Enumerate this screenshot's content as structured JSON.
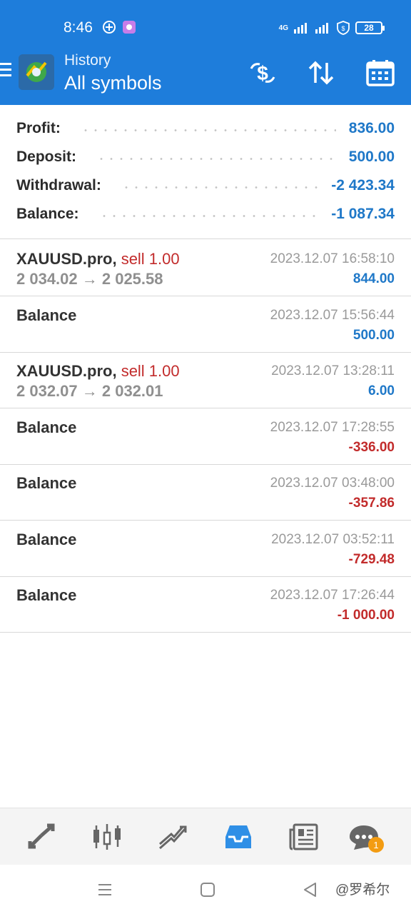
{
  "status_bar": {
    "time": "8:46",
    "network": "4G",
    "battery": "28"
  },
  "toolbar": {
    "title": "History",
    "subtitle": "All symbols"
  },
  "summary": {
    "rows": [
      {
        "label": "Profit:",
        "value": "836.00"
      },
      {
        "label": "Deposit:",
        "value": "500.00"
      },
      {
        "label": "Withdrawal:",
        "value": "-2 423.34"
      },
      {
        "label": "Balance:",
        "value": "-1 087.34"
      }
    ]
  },
  "deals": [
    {
      "symbol": "XAUUSD.pro,",
      "type": "sell 1.00",
      "prices": "2 034.02 → 2 025.58",
      "time": "2023.12.07 16:58:10",
      "profit": "844.00",
      "sign": "pos"
    },
    {
      "symbol": "Balance",
      "type": "",
      "prices": "",
      "time": "2023.12.07 15:56:44",
      "profit": "500.00",
      "sign": "pos"
    },
    {
      "symbol": "XAUUSD.pro,",
      "type": "sell 1.00",
      "prices": "2 032.07 → 2 032.01",
      "time": "2023.12.07 13:28:11",
      "profit": "6.00",
      "sign": "pos"
    },
    {
      "symbol": "Balance",
      "type": "",
      "prices": "",
      "time": "2023.12.07 17:28:55",
      "profit": "-336.00",
      "sign": "neg"
    },
    {
      "symbol": "Balance",
      "type": "",
      "prices": "",
      "time": "2023.12.07 03:48:00",
      "profit": "-357.86",
      "sign": "neg"
    },
    {
      "symbol": "Balance",
      "type": "",
      "prices": "",
      "time": "2023.12.07 03:52:11",
      "profit": "-729.48",
      "sign": "neg"
    },
    {
      "symbol": "Balance",
      "type": "",
      "prices": "",
      "time": "2023.12.07 17:26:44",
      "profit": "-1 000.00",
      "sign": "neg"
    }
  ],
  "bottom_nav": {
    "items": [
      "quotes-icon",
      "chart-icon",
      "trade-icon",
      "history-icon",
      "news-icon",
      "chat-icon"
    ],
    "active": "history-icon",
    "chat_badge": "1"
  },
  "watermark": "@罗希尔",
  "colors": {
    "header": "#1e7ddb",
    "positive": "#1f78c8",
    "negative": "#c22b2b",
    "active_tab": "#2f8fe6"
  }
}
